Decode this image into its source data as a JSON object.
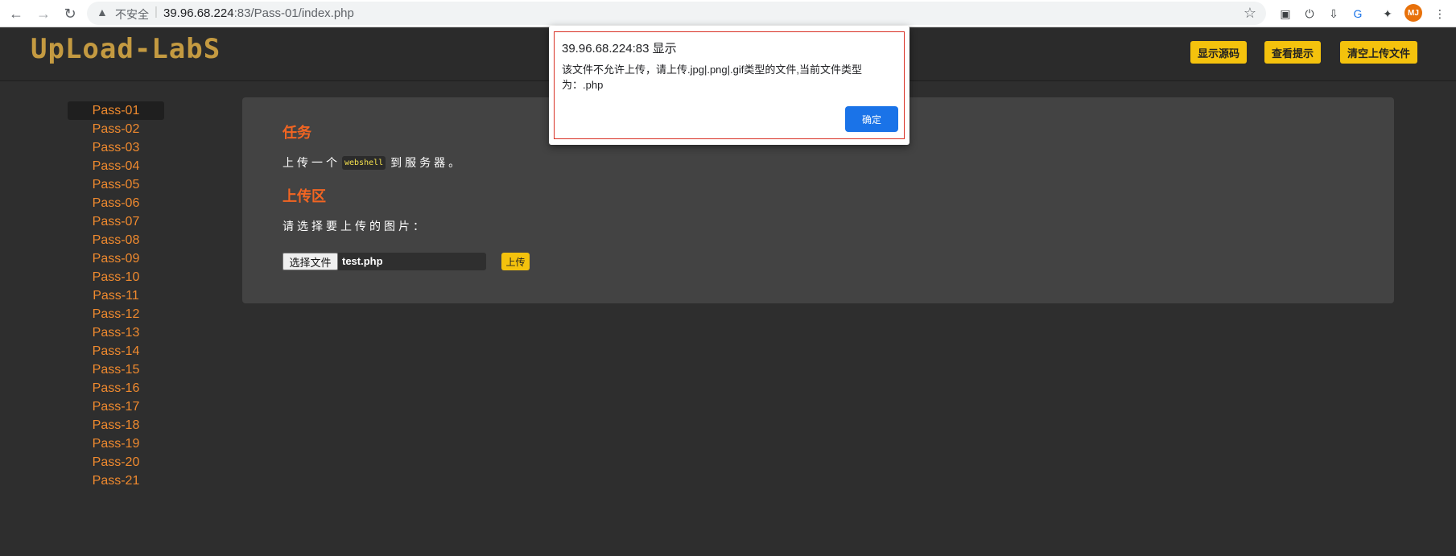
{
  "browser": {
    "insecure_label": "不安全",
    "url_host": "39.96.68.224",
    "url_port": ":83",
    "url_path": "/Pass-01/index.php",
    "profile_initials": "MJ"
  },
  "site": {
    "logo": "UpLoad-LabS",
    "buttons": {
      "show_source": "显示源码",
      "view_hint": "查看提示",
      "clear_uploads": "清空上传文件"
    }
  },
  "sidebar": {
    "items": [
      "Pass-01",
      "Pass-02",
      "Pass-03",
      "Pass-04",
      "Pass-05",
      "Pass-06",
      "Pass-07",
      "Pass-08",
      "Pass-09",
      "Pass-10",
      "Pass-11",
      "Pass-12",
      "Pass-13",
      "Pass-14",
      "Pass-15",
      "Pass-16",
      "Pass-17",
      "Pass-18",
      "Pass-19",
      "Pass-20",
      "Pass-21"
    ],
    "active": "Pass-01"
  },
  "main": {
    "task_heading": "任务",
    "task_prefix": "上传一个",
    "task_code": "webshell",
    "task_suffix": "到服务器。",
    "upload_heading": "上传区",
    "choose_label": "请选择要上传的图片：",
    "file_button": "选择文件",
    "file_name": "test.php",
    "upload_button": "上传"
  },
  "dialog": {
    "title": "39.96.68.224:83 显示",
    "message": "该文件不允许上传，请上传.jpg|.png|.gif类型的文件,当前文件类型为：.php",
    "ok": "确定"
  },
  "colors": {
    "accent_yellow": "#f4c20d",
    "heading_orange": "#f26522",
    "link_orange": "#f08a2e",
    "logo_gold": "#c49a41",
    "dialog_blue": "#1a73e8"
  }
}
